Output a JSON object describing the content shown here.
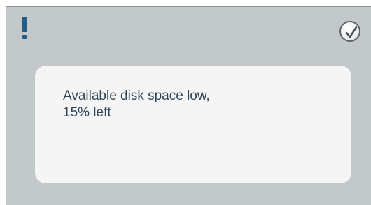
{
  "dialog": {
    "icon": "exclamation-icon",
    "confirm_icon": "checkmark-icon",
    "message": {
      "line1": "Available disk space low,",
      "line2": "15% left"
    },
    "colors": {
      "background": "#c3c8cb",
      "card": "#f5f5f5",
      "accent": "#255c86",
      "text": "#2f4659"
    }
  }
}
